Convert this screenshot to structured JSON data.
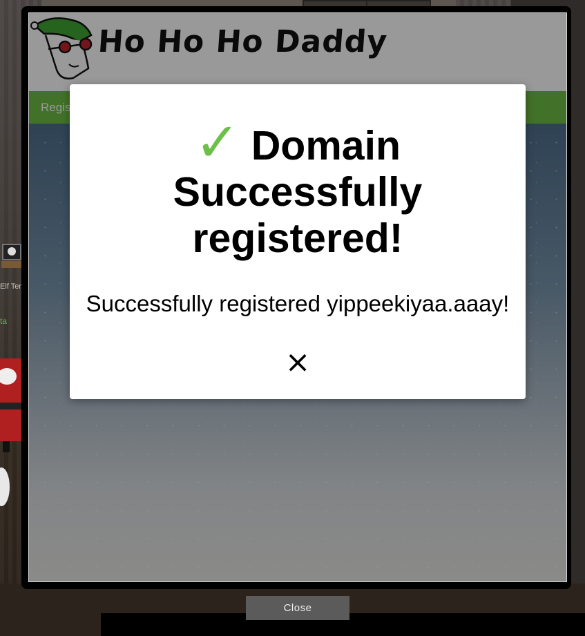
{
  "site": {
    "logo_text": "Ho Ho Ho Daddy",
    "nav_item": "Regis"
  },
  "background": {
    "left_label": "Elf Ter",
    "left_link": "ta"
  },
  "modal": {
    "title_rest": "Domain Successfully registered!",
    "message": "Successfully registered yippeekiyaa.aaay!",
    "close_symbol": "×"
  },
  "close_button": {
    "label": "Close"
  },
  "colors": {
    "check_green": "#6cc04a",
    "nav_green": "#6fbf45",
    "close_button_bg": "#5b5b5b"
  },
  "icons": {
    "check": "check-icon",
    "close": "close-icon",
    "logo": "elf-logo-icon"
  }
}
